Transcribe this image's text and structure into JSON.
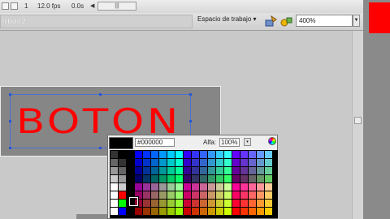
{
  "timeline": {
    "frame": "1",
    "fps": "12.0 fps",
    "time": "0.0s",
    "scroll_glyph": "|||"
  },
  "editbar": {
    "scene_label": "mbolo 2",
    "workspace_label": "Espacio de trabajo ▾",
    "zoom": "400%",
    "zoom_arrow": "▼",
    "icons": [
      "edit-scene-icon",
      "edit-symbol-icon"
    ]
  },
  "stage": {
    "button_text": "BOTON",
    "text_color": "#ff0000"
  },
  "picker": {
    "hex_value": "#000000",
    "alpha_label": "Alfa:",
    "alpha_value": "100%",
    "alpha_arrow": "▾",
    "selected_color": "#000000"
  },
  "colors": {
    "accent_red": "#ff0000",
    "selection_blue": "#2a54d4"
  }
}
